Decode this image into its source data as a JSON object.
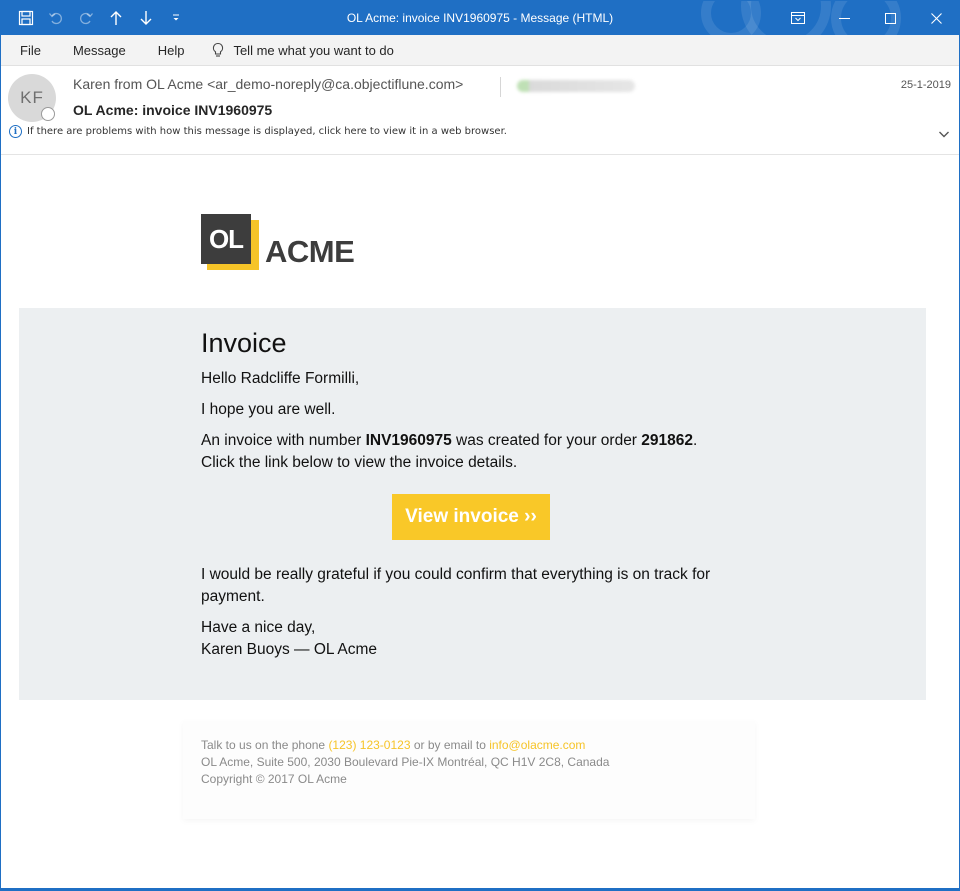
{
  "window": {
    "title": "OL Acme: invoice INV1960975  -  Message (HTML)",
    "accent": "#1f6fc4"
  },
  "menu": {
    "file": "File",
    "message": "Message",
    "help": "Help",
    "tell_me": "Tell me what you want to do"
  },
  "header": {
    "avatar_initials": "KF",
    "sender": "Karen from OL Acme <ar_demo-noreply@ca.objectiflune.com>",
    "date": "25-1-2019",
    "subject": "OL Acme: invoice INV1960975",
    "info": "If there are problems with how this message is displayed, click here to view it in a web browser."
  },
  "email": {
    "logo_box": "OL",
    "logo_text": "ACME",
    "heading": "Invoice",
    "greeting": "Hello Radcliffe Formilli,",
    "hope": "I hope you are well.",
    "line1_pre": "An invoice with number ",
    "invoice_number": "INV1960975",
    "line1_mid": " was created for your order ",
    "order_number": "291862",
    "line1_post": ".",
    "line2": "Click the link below to view the invoice details.",
    "button": "View invoice ››",
    "grateful": "I would be really grateful if you could confirm that everything is on track for payment.",
    "closing": "Have a nice day,",
    "signature": "Karen Buoys — OL Acme",
    "brand_yellow": "#f9c828",
    "panel_bg": "#eceff1"
  },
  "footer": {
    "talk_pre": "Talk to us on the phone ",
    "phone": "(123) 123-0123",
    "talk_mid": " or by email to ",
    "email": "info@olacme.com",
    "address": "OL Acme, Suite 500, 2030 Boulevard Pie-IX Montréal, QC H1V 2C8, Canada",
    "copyright": "Copyright © 2017 OL Acme"
  }
}
